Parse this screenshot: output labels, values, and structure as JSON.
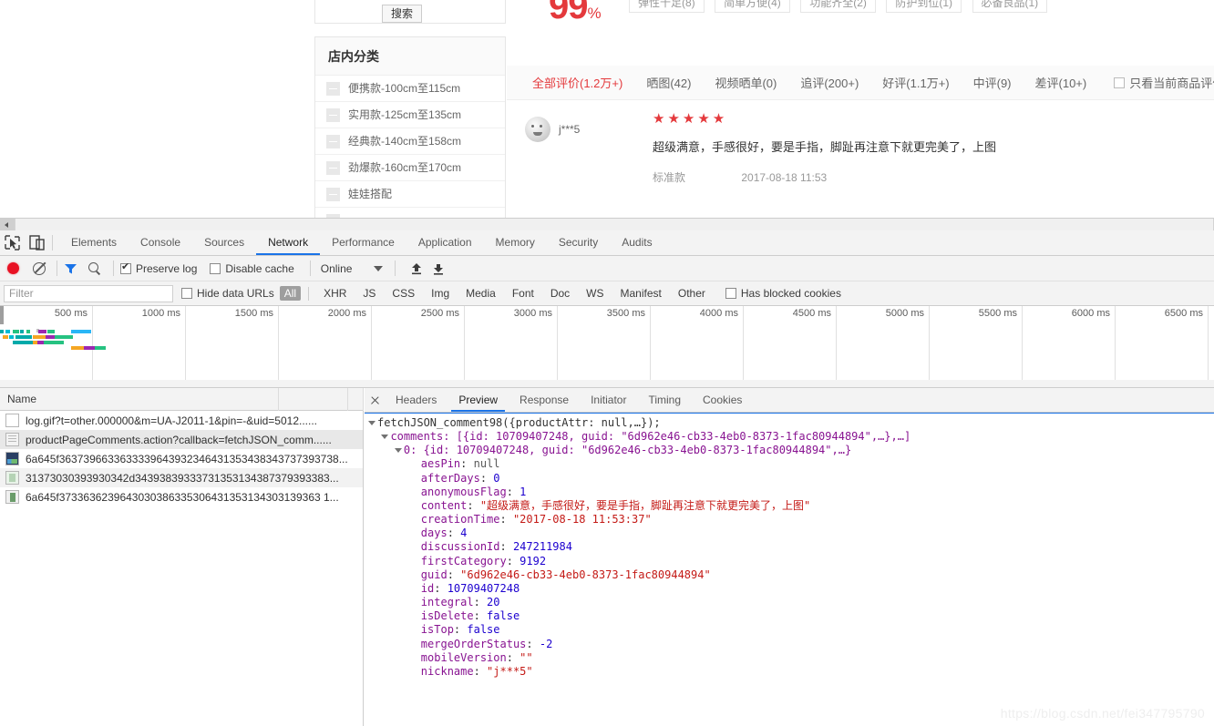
{
  "page": {
    "search": {
      "button_label": "搜索"
    },
    "store_category": {
      "title": "店内分类",
      "items": [
        {
          "label": "便携款-100cm至115cm"
        },
        {
          "label": "实用款-125cm至135cm"
        },
        {
          "label": "经典款-140cm至158cm"
        },
        {
          "label": "劲爆款-160cm至170cm"
        },
        {
          "label": "娃娃搭配"
        }
      ]
    },
    "score": {
      "value": "99",
      "symbol": "%",
      "color": "#e4393c"
    },
    "tags": [
      {
        "label": "弹性十足(8)"
      },
      {
        "label": "简单方便(4)"
      },
      {
        "label": "功能齐全(2)"
      },
      {
        "label": "防护到位(1)"
      },
      {
        "label": "必备良品(1)"
      }
    ],
    "review_filters": [
      {
        "label": "全部评价(1.2万+)",
        "active": true
      },
      {
        "label": "晒图(42)",
        "active": false
      },
      {
        "label": "视频晒单(0)",
        "active": false
      },
      {
        "label": "追评(200+)",
        "active": false
      },
      {
        "label": "好评(1.1万+)",
        "active": false
      },
      {
        "label": "中评(9)",
        "active": false
      },
      {
        "label": "差评(10+)",
        "active": false
      }
    ],
    "only_current_label": "只看当前商品评价",
    "comment": {
      "nickname": "j***5",
      "stars": "★★★★★",
      "text": "超级满意，手感很好，要是手指，脚趾再注意下就更完美了，上图",
      "spec": "标准款",
      "time": "2017-08-18 11:53"
    }
  },
  "devtools": {
    "main_tabs": [
      {
        "label": "Elements",
        "active": false
      },
      {
        "label": "Console",
        "active": false
      },
      {
        "label": "Sources",
        "active": false
      },
      {
        "label": "Network",
        "active": true
      },
      {
        "label": "Performance",
        "active": false
      },
      {
        "label": "Application",
        "active": false
      },
      {
        "label": "Memory",
        "active": false
      },
      {
        "label": "Security",
        "active": false
      },
      {
        "label": "Audits",
        "active": false
      }
    ],
    "controls": {
      "preserve_log_label": "Preserve log",
      "preserve_log_checked": true,
      "disable_cache_label": "Disable cache",
      "disable_cache_checked": false,
      "throttling_value": "Online"
    },
    "filter": {
      "placeholder": "Filter",
      "value": "",
      "hide_data_urls_label": "Hide data URLs",
      "hide_data_urls_checked": false,
      "types": [
        {
          "label": "All",
          "active": true
        },
        {
          "label": "XHR",
          "active": false
        },
        {
          "label": "JS",
          "active": false
        },
        {
          "label": "CSS",
          "active": false
        },
        {
          "label": "Img",
          "active": false
        },
        {
          "label": "Media",
          "active": false
        },
        {
          "label": "Font",
          "active": false
        },
        {
          "label": "Doc",
          "active": false
        },
        {
          "label": "WS",
          "active": false
        },
        {
          "label": "Manifest",
          "active": false
        },
        {
          "label": "Other",
          "active": false
        }
      ],
      "has_blocked_cookies_label": "Has blocked cookies",
      "has_blocked_cookies_checked": false
    },
    "timeline": {
      "ticks": [
        "500 ms",
        "1000 ms",
        "1500 ms",
        "2000 ms",
        "2500 ms",
        "3000 ms",
        "3500 ms",
        "4000 ms",
        "4500 ms",
        "5000 ms",
        "5500 ms",
        "6000 ms",
        "6500 ms"
      ]
    },
    "requests": {
      "column_header": "Name",
      "rows": [
        {
          "name": "log.gif?t=other.000000&m=UA-J2011-1&pin=-&uid=5012......",
          "icon": "doc-icon",
          "selected": false
        },
        {
          "name": "productPageComments.action?callback=fetchJSON_comm......",
          "icon": "script-icon",
          "selected": true
        },
        {
          "name": "6a645f3637396633633339643932346431353438343737393738...",
          "icon": "image-icon",
          "selected": false
        },
        {
          "name": "31373030393930342d34393839333731353134387379393383...",
          "icon": "image-icon",
          "selected": false
        },
        {
          "name": "6a645f3733636239643030386335306431353134303139363 1...",
          "icon": "image-icon",
          "selected": false
        }
      ]
    },
    "detail_tabs": [
      {
        "label": "Headers",
        "active": false
      },
      {
        "label": "Preview",
        "active": true
      },
      {
        "label": "Response",
        "active": false
      },
      {
        "label": "Initiator",
        "active": false
      },
      {
        "label": "Timing",
        "active": false
      },
      {
        "label": "Cookies",
        "active": false
      }
    ],
    "preview_json": {
      "root": "fetchJSON_comment98({productAttr: null,…});",
      "comments_line": "comments: [{id: 10709407248, guid: \"6d962e46-cb33-4eb0-8373-1fac80944894\",…},…]",
      "index_line": "0: {id: 10709407248, guid: \"6d962e46-cb33-4eb0-8373-1fac80944894\",…}",
      "fields": [
        {
          "key": "aesPin",
          "value": "null",
          "kind": "null"
        },
        {
          "key": "afterDays",
          "value": "0",
          "kind": "num"
        },
        {
          "key": "anonymousFlag",
          "value": "1",
          "kind": "num"
        },
        {
          "key": "content",
          "value": "\"超级满意，手感很好，要是手指，脚趾再注意下就更完美了，上图\"",
          "kind": "str"
        },
        {
          "key": "creationTime",
          "value": "\"2017-08-18 11:53:37\"",
          "kind": "str"
        },
        {
          "key": "days",
          "value": "4",
          "kind": "num"
        },
        {
          "key": "discussionId",
          "value": "247211984",
          "kind": "num"
        },
        {
          "key": "firstCategory",
          "value": "9192",
          "kind": "num"
        },
        {
          "key": "guid",
          "value": "\"6d962e46-cb33-4eb0-8373-1fac80944894\"",
          "kind": "str"
        },
        {
          "key": "id",
          "value": "10709407248",
          "kind": "num"
        },
        {
          "key": "integral",
          "value": "20",
          "kind": "num"
        },
        {
          "key": "isDelete",
          "value": "false",
          "kind": "bool"
        },
        {
          "key": "isTop",
          "value": "false",
          "kind": "bool"
        },
        {
          "key": "mergeOrderStatus",
          "value": "-2",
          "kind": "num"
        },
        {
          "key": "mobileVersion",
          "value": "\"\"",
          "kind": "str"
        },
        {
          "key": "nickname",
          "value": "\"j***5\"",
          "kind": "str"
        }
      ]
    }
  },
  "watermark": "https://blog.csdn.net/fei347795790"
}
